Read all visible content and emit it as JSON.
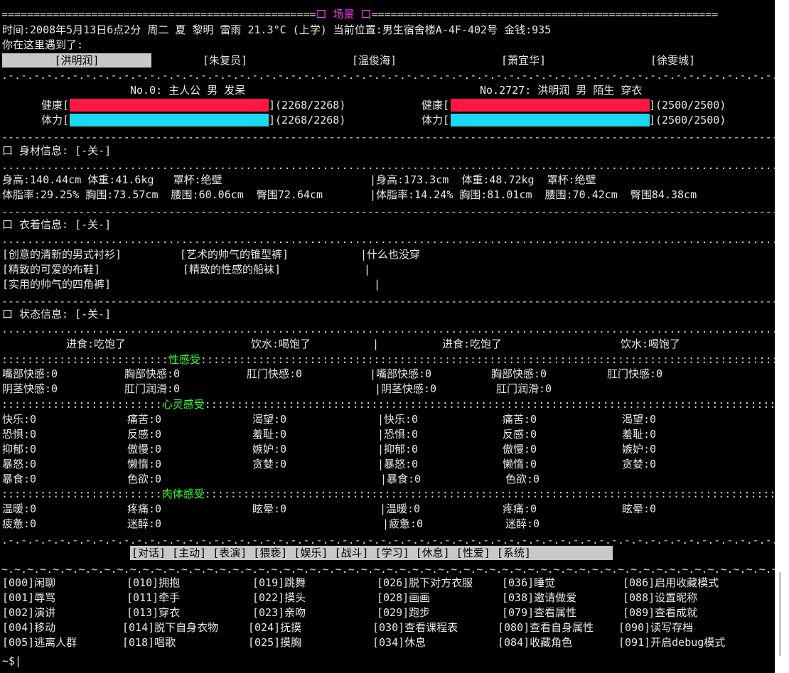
{
  "scene": {
    "title": "口 场景 口",
    "status_line": "时间:2008年5月13日6点2分 周二 夏 黎明 雷雨 21.3°C (上学) 当前位置:男生宿舍楼A-4F-402号 金钱:935",
    "met_label": "你在这里遇到了:",
    "people": [
      "[洪明润]",
      "[朱复员]",
      "[温俊海]",
      "[萧宜华]",
      "[徐雯城]"
    ]
  },
  "player": {
    "header": "No.0: 主人公 男 发呆",
    "health_label": "健康[",
    "health_value": "](2268/2268)",
    "stamina_label": "体力[",
    "stamina_value": "](2268/2268)",
    "health_fraction": 1.0,
    "stamina_fraction": 1.0
  },
  "target": {
    "header": "No.2727: 洪明润 男 陌生 穿衣",
    "health_label": "健康[",
    "health_value": "](2500/2500)",
    "stamina_label": "体力[",
    "stamina_value": "](2500/2500)",
    "health_fraction": 1.0,
    "stamina_fraction": 1.0
  },
  "body": {
    "title": "口 身材信息: [-关-]",
    "left_1": "身高:140.44cm 体重:41.6kg   罩杯:绝壁",
    "left_2": "体脂率:29.25% 胸围:73.57cm  腰围:60.06cm  臀围72.64cm",
    "right_1": "|身高:173.3cm  体重:48.72kg  罩杯:绝壁",
    "right_2": "|体脂率:14.24% 胸围:81.01cm  腰围:70.42cm  臀围84.38cm"
  },
  "clothes": {
    "title": "口 衣着信息: [-关-]",
    "items": [
      "[创意的清新的男式衬衫]",
      "[艺术的帅气的锥型裤]",
      "[精致的可爱的布鞋]",
      "[精致的性感的船袜]",
      "[实用的帅气的四角裤]"
    ],
    "right": "|什么也没穿",
    "pipe": "|"
  },
  "status": {
    "title": "口 状态信息: [-关-]",
    "eat": "进食:吃饱了",
    "drink": "饮水:喝饱了",
    "pipe": "|",
    "sex_title": "性感受",
    "sex": [
      "嘴部快感:0",
      "胸部快感:0",
      "肛门快感:0",
      "阴茎快感:0",
      "肛门润滑:0"
    ],
    "sex_right": [
      "|嘴部快感:0",
      "胸部快感:0",
      "肛门快感:0",
      "|阴茎快感:0",
      "肛门润滑:0"
    ],
    "mind_title": "心灵感受",
    "mind": [
      "快乐:0",
      "痛苦:0",
      "渴望:0",
      "恐惧:0",
      "反感:0",
      "羞耻:0",
      "抑郁:0",
      "傲慢:0",
      "嫉妒:0",
      "暴怒:0",
      "懒惰:0",
      "贪婪:0",
      "暴食:0",
      "色欲:0"
    ],
    "mind_right": [
      "|快乐:0",
      "痛苦:0",
      "渴望:0",
      "|恐惧:0",
      "反感:0",
      "羞耻:0",
      "|抑郁:0",
      "傲慢:0",
      "嫉妒:0",
      "|暴怒:0",
      "懒惰:0",
      "贪婪:0",
      "|暴食:0",
      "色欲:0"
    ],
    "flesh_title": "肉体感受",
    "flesh": [
      "温暖:0",
      "疼痛:0",
      "眩晕:0",
      "疲惫:0",
      "迷醉:0"
    ],
    "flesh_right": [
      "|温暖:0",
      "疼痛:0",
      "眩晕:0",
      "|疲惫:0",
      "迷醉:0"
    ]
  },
  "menu": {
    "categories": "[对话] [主动] [表演] [猥亵] [娱乐] [战斗] [学习] [休息] [性爱] [系统]"
  },
  "commands": [
    [
      "[000]闲聊",
      "[010]拥抱",
      "[019]跳舞",
      "[026]脱下对方衣服",
      "[036]睡觉",
      "[086]启用收藏模式"
    ],
    [
      "[001]辱骂",
      "[011]牵手",
      "[022]摸头",
      "[028]画画",
      "[038]邀请做爱",
      "[088]设置昵称"
    ],
    [
      "[002]演讲",
      "[013]穿衣",
      "[023]亲吻",
      "[029]跑步",
      "[079]查看属性",
      "[089]查看成就"
    ],
    [
      "[004]移动",
      "[014]脱下自身衣物",
      "[024]抚摸",
      "[030]查看课程表",
      "[080]查看自身属性",
      "[090]读写存档"
    ],
    [
      "[005]逃离人群",
      "[018]唱歌",
      "[025]摸胸",
      "[034]休息",
      "[084]收藏角色",
      "[091]开启debug模式"
    ]
  ],
  "prompt": "~$|"
}
